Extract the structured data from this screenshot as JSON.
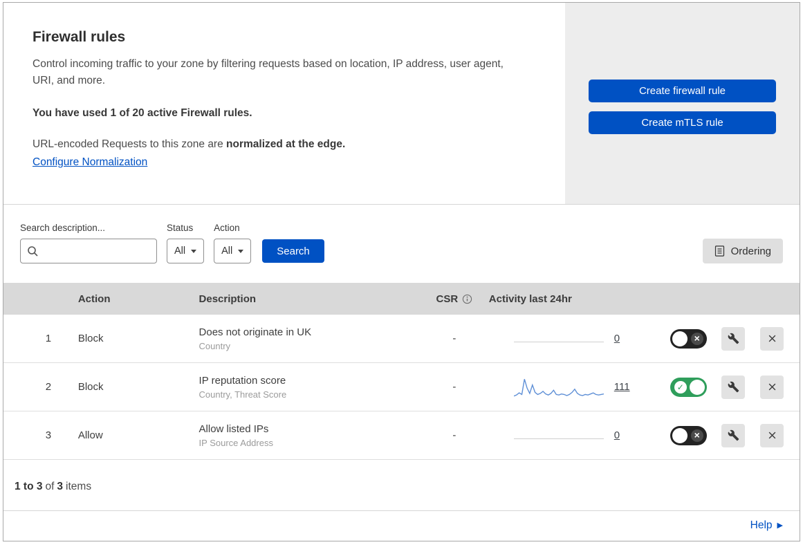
{
  "header": {
    "title": "Firewall rules",
    "description": "Control incoming traffic to your zone by filtering requests based on location, IP address, user agent, URI, and more.",
    "usage": "You have used 1 of 20 active Firewall rules.",
    "normalization_prefix": "URL-encoded Requests to this zone are ",
    "normalization_bold": "normalized at the edge.",
    "configure_link": "Configure Normalization",
    "create_firewall_button": "Create firewall rule",
    "create_mtls_button": "Create mTLS rule"
  },
  "filters": {
    "search_label": "Search description...",
    "status_label": "Status",
    "status_value": "All",
    "action_label": "Action",
    "action_value": "All",
    "search_button": "Search",
    "ordering_button": "Ordering"
  },
  "table": {
    "headers": {
      "action": "Action",
      "description": "Description",
      "csr": "CSR",
      "activity": "Activity last 24hr"
    },
    "rows": [
      {
        "num": "1",
        "action": "Block",
        "description": "Does not originate in UK",
        "criteria": "Country",
        "csr": "-",
        "activity_count": "0",
        "enabled": "false",
        "sparkline": []
      },
      {
        "num": "2",
        "action": "Block",
        "description": "IP reputation score",
        "criteria": "Country, Threat Score",
        "csr": "-",
        "activity_count": "111",
        "enabled": "true",
        "sparkline": [
          3,
          5,
          9,
          6,
          35,
          18,
          8,
          24,
          10,
          6,
          8,
          12,
          7,
          5,
          8,
          14,
          6,
          5,
          7,
          6,
          4,
          6,
          10,
          16,
          8,
          5,
          4,
          6,
          5,
          7,
          9,
          6,
          5,
          6,
          7
        ]
      },
      {
        "num": "3",
        "action": "Allow",
        "description": "Allow listed IPs",
        "criteria": "IP Source Address",
        "csr": "-",
        "activity_count": "0",
        "enabled": "false",
        "sparkline": []
      }
    ]
  },
  "footer": {
    "range": "1 to 3",
    "of_text": "of",
    "total": "3",
    "items_text": "items",
    "help_link": "Help"
  },
  "colors": {
    "primary": "#0051c3",
    "toggle_on": "#2f9e5b",
    "sparkline": "#5e8fd6"
  }
}
